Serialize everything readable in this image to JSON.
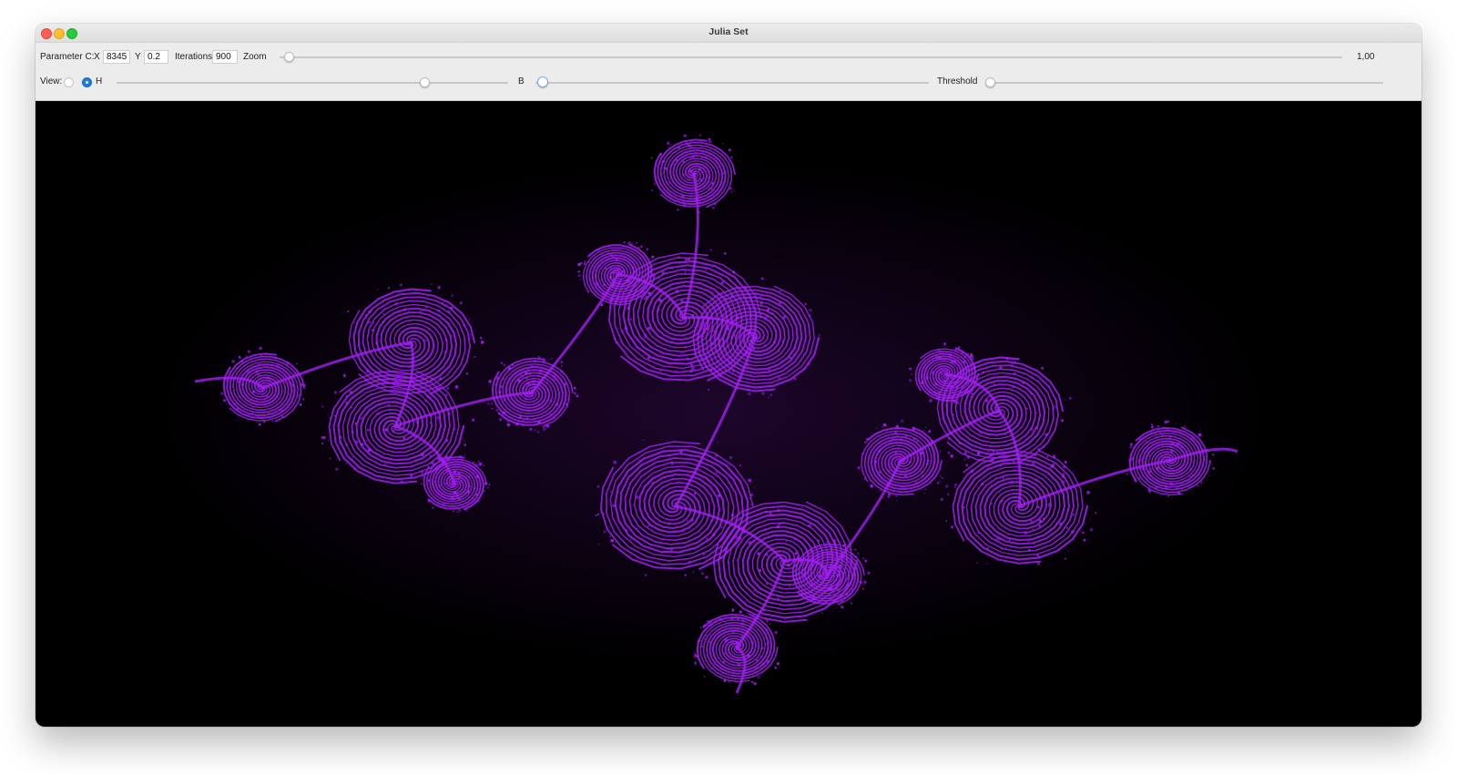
{
  "window": {
    "title": "Julia Set"
  },
  "controls": {
    "parameter_label": "Parameter C:",
    "x_label": "X",
    "x_value": "8345",
    "y_label": "Y",
    "y_value": "0.2",
    "iterations_label": "Iterations",
    "iterations_value": "900",
    "zoom_label": "Zoom",
    "zoom_value": "1,00",
    "view_label": "View:",
    "view_options": [
      {
        "label": "",
        "selected": false
      },
      {
        "label": "H",
        "selected": true
      }
    ],
    "b_label": "B",
    "threshold_label": "Threshold"
  },
  "colors": {
    "fractal": "#a020f0",
    "background": "#000000",
    "accent": "#1f7ae0"
  }
}
